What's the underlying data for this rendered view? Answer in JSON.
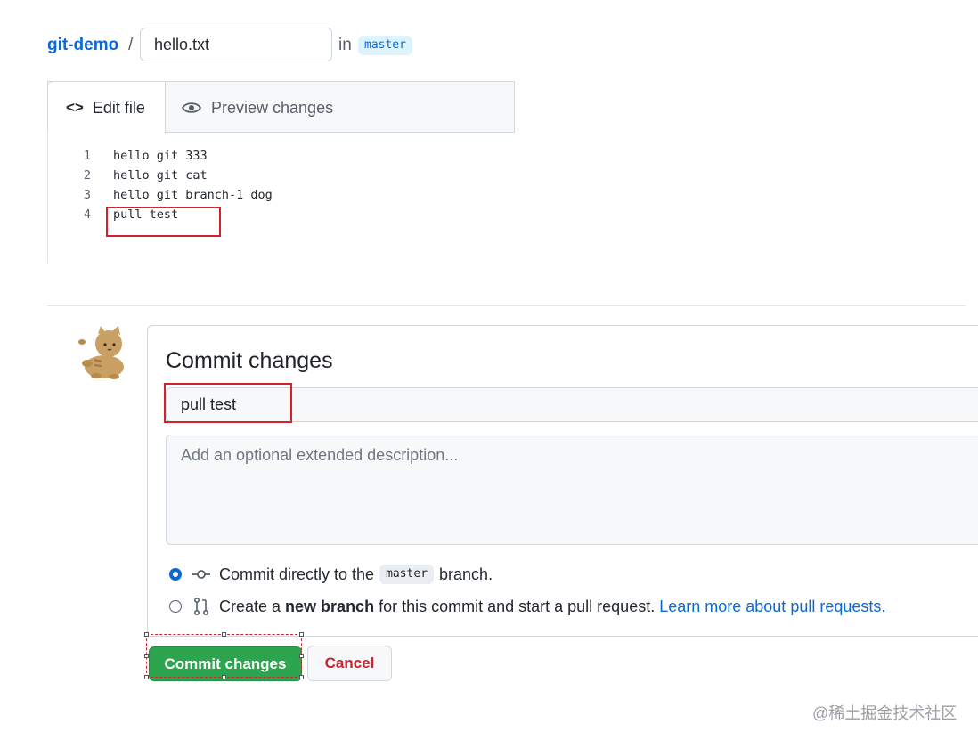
{
  "breadcrumb": {
    "repo": "git-demo",
    "separator": "/",
    "filename": "hello.txt",
    "in_word": "in",
    "branch": "master"
  },
  "editor": {
    "tabs": [
      {
        "label": "Edit file",
        "icon": "code-icon",
        "active": true
      },
      {
        "label": "Preview changes",
        "icon": "eye-icon",
        "active": false
      }
    ],
    "lines": [
      {
        "num": "1",
        "text": "hello git 333"
      },
      {
        "num": "2",
        "text": "hello git cat"
      },
      {
        "num": "3",
        "text": "hello git branch-1 dog"
      },
      {
        "num": "4",
        "text": "pull test"
      }
    ]
  },
  "commit": {
    "title": "Commit changes",
    "summary_value": "pull test",
    "description_placeholder": "Add an optional extended description...",
    "option_direct": {
      "prefix": "Commit directly to the",
      "branch": "master",
      "suffix": "branch.",
      "selected": true,
      "icon": "git-commit-icon"
    },
    "option_new_branch": {
      "prefix": "Create a",
      "bold": "new branch",
      "suffix": "for this commit and start a pull request.",
      "link": "Learn more about pull requests.",
      "selected": false,
      "icon": "git-pull-request-icon"
    },
    "commit_button": "Commit changes",
    "cancel_button": "Cancel"
  },
  "watermark": "@稀土掘金技术社区",
  "colors": {
    "link": "#0969da",
    "primary_button": "#2da44e",
    "danger": "#cf222e",
    "annotation_red": "#d0242b"
  }
}
